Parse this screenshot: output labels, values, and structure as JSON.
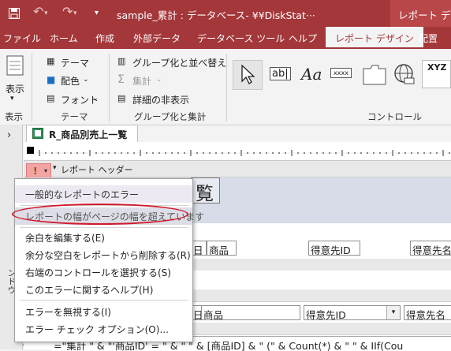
{
  "window": {
    "doc_title": "sample_累計 : データベース- ¥¥DiskStat···",
    "context_title": "レポート デザイ"
  },
  "ribbon_tabs": [
    "ファイル",
    "ホーム",
    "作成",
    "外部データ",
    "データベース ツール",
    "ヘルプ",
    "レポート デザイン",
    "配置"
  ],
  "ribbon": {
    "view": {
      "label": "表示",
      "group": "表示"
    },
    "theme": {
      "themes": "テーマ",
      "colors": "配色",
      "fonts": "フォント",
      "group": "テーマ"
    },
    "grouping": {
      "group_sort": "グループ化と並べ替え",
      "totals": "集計",
      "hide_details": "詳細の非表示",
      "group": "グループ化と集計"
    },
    "controls": {
      "textbox": "ab|",
      "label": "Aa",
      "button": "xxxx",
      "chart": "XYZ",
      "group": "コントロール"
    }
  },
  "document_tab": "R_商品別売上一覧",
  "nav_pane_label": "ナビゲーション ウィンドウ",
  "report": {
    "header_section": "レポート ヘッダー",
    "title_char": "覧",
    "page_header_fields": [
      "日",
      "商品",
      "得意先ID",
      "得意先名"
    ],
    "detail_fields": [
      "日",
      "商品",
      "得意先ID",
      "得意先名"
    ],
    "footer_expression": "=\"集計 \" & \"'商品ID' = \" & \" \" & [商品ID] & \" (\" & Count(*) & \" \" & IIf(Cou"
  },
  "error_menu": {
    "title": "一般的なレポートのエラー",
    "items": [
      "レポートの幅がページの幅を超えています",
      "余白を編集する(E)",
      "余分な空白をレポートから削除する(R)",
      "右端のコントロールを選択する(S)",
      "このエラーに関するヘルプ(H)",
      "エラーを無視する(I)",
      "エラー チェック オプション(O)..."
    ]
  },
  "colors": {
    "accent": "#a4373a",
    "highlight_oval": "#d0192a",
    "band": "#d7dce8"
  }
}
